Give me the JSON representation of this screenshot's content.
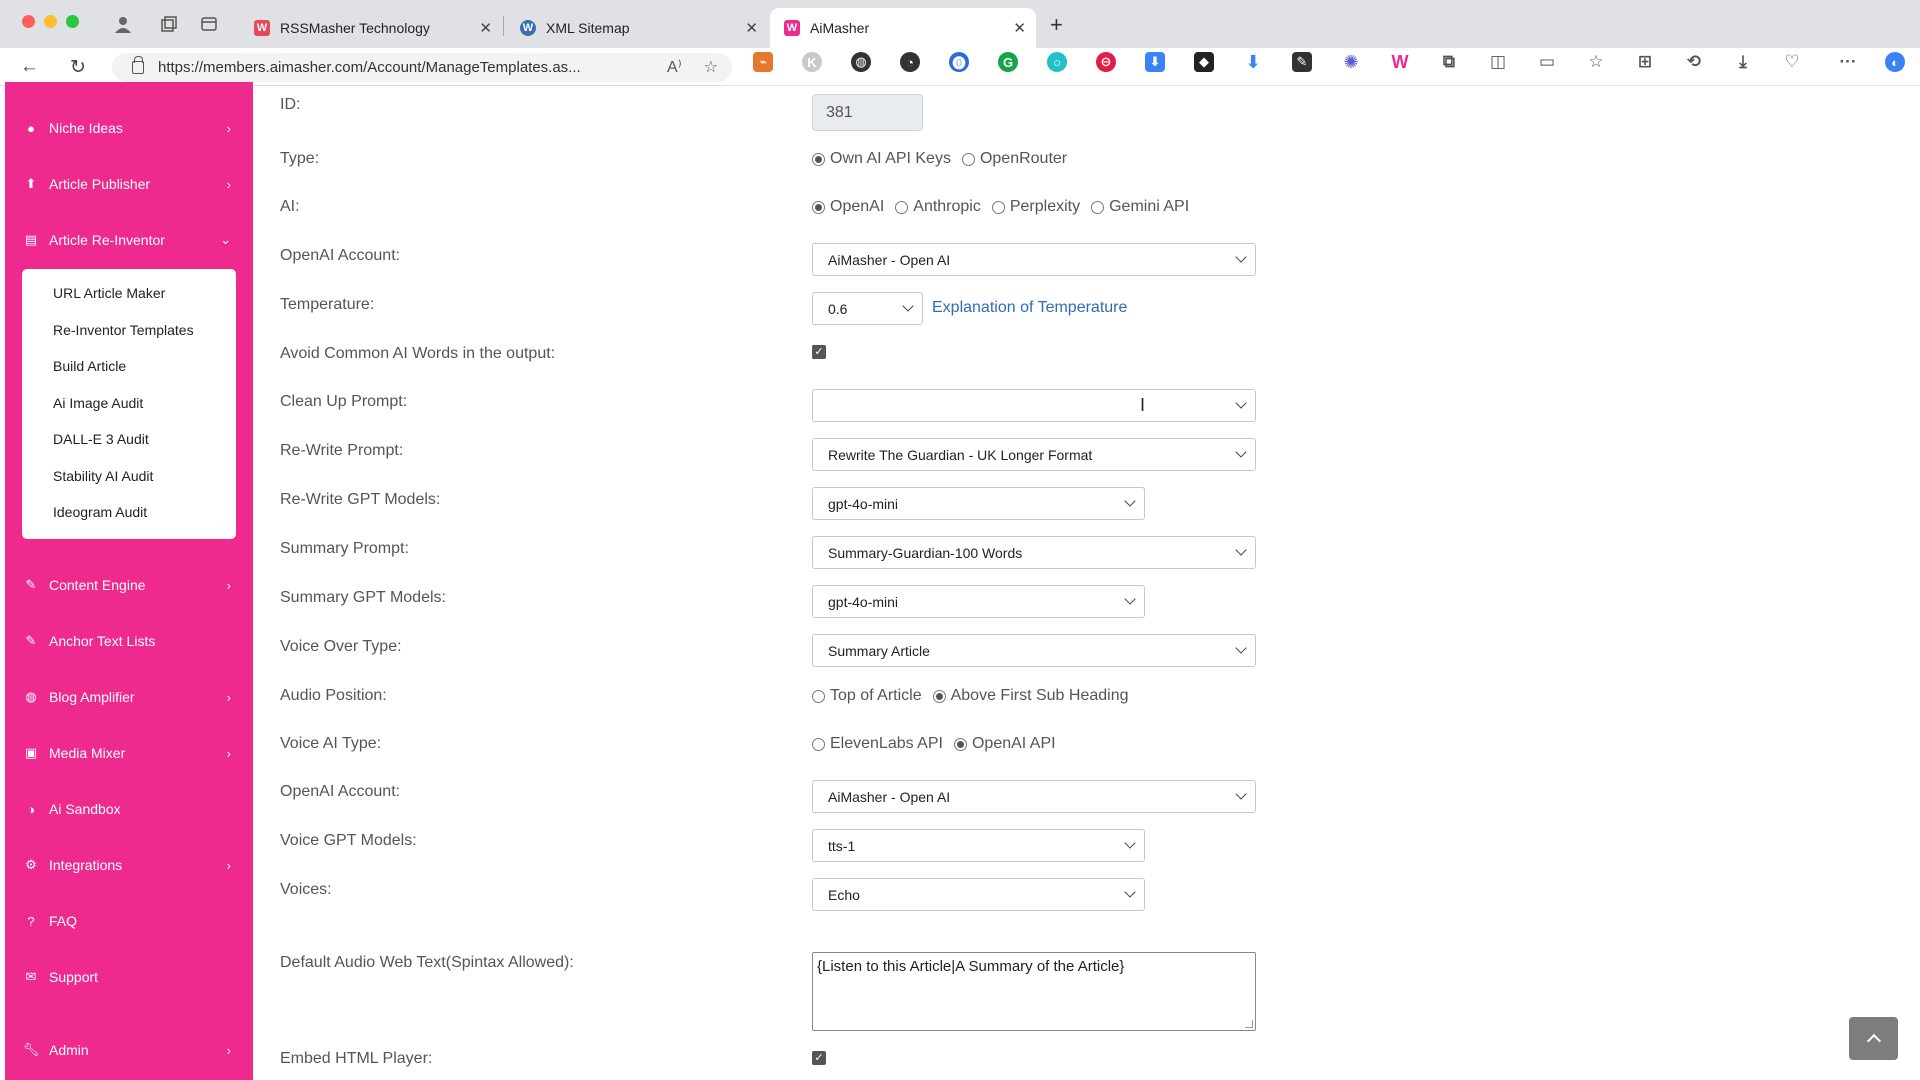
{
  "browser": {
    "tabs": [
      {
        "title": "RSSMasher Technology",
        "active": false
      },
      {
        "title": "XML Sitemap",
        "active": false
      },
      {
        "title": "AiMasher",
        "active": true
      }
    ],
    "url": "https://members.aimasher.com/Account/ManageTemplates.as...",
    "colors": {
      "tabbar": "#dfe1e5",
      "accent": "#ee2a8e"
    }
  },
  "sidebar": {
    "items": [
      {
        "label": "Niche Ideas",
        "icon": "lightbulb-icon",
        "chevron": "right"
      },
      {
        "label": "Article Publisher",
        "icon": "upload-icon",
        "chevron": "right"
      },
      {
        "label": "Article Re-Inventor",
        "icon": "list-icon",
        "chevron": "down"
      },
      {
        "label": "Content Engine",
        "icon": "edit-icon",
        "chevron": "right"
      },
      {
        "label": "Anchor Text Lists",
        "icon": "edit-icon",
        "chevron": ""
      },
      {
        "label": "Blog Amplifier",
        "icon": "globe-icon",
        "chevron": "right"
      },
      {
        "label": "Media Mixer",
        "icon": "image-icon",
        "chevron": "right"
      },
      {
        "label": "Ai Sandbox",
        "icon": "brain-icon",
        "chevron": ""
      },
      {
        "label": "Integrations",
        "icon": "gear-icon",
        "chevron": "right"
      },
      {
        "label": "FAQ",
        "icon": "question-icon",
        "chevron": ""
      },
      {
        "label": "Support",
        "icon": "envelope-icon",
        "chevron": ""
      },
      {
        "label": "Admin",
        "icon": "wrench-icon",
        "chevron": "right"
      }
    ],
    "submenu": [
      "URL Article Maker",
      "Re-Inventor Templates",
      "Build Article",
      "Ai Image Audit",
      "DALL-E 3 Audit",
      "Stability AI Audit",
      "Ideogram Audit"
    ]
  },
  "form": {
    "id": {
      "label": "ID:",
      "value": "381"
    },
    "type": {
      "label": "Type:",
      "options": [
        "Own AI API Keys",
        "OpenRouter"
      ],
      "selected": "Own AI API Keys"
    },
    "ai": {
      "label": "AI:",
      "options": [
        "OpenAI",
        "Anthropic",
        "Perplexity",
        "Gemini API"
      ],
      "selected": "OpenAI"
    },
    "openai_account": {
      "label": "OpenAI Account:",
      "value": "AiMasher - Open AI"
    },
    "temperature": {
      "label": "Temperature:",
      "value": "0.6",
      "link": "Explanation of Temperature"
    },
    "avoid_words": {
      "label": "Avoid Common AI Words in the output:",
      "checked": true
    },
    "cleanup_prompt": {
      "label": "Clean Up Prompt:",
      "value": ""
    },
    "rewrite_prompt": {
      "label": "Re-Write Prompt:",
      "value": "Rewrite The Guardian - UK Longer Format"
    },
    "rewrite_models": {
      "label": "Re-Write GPT Models:",
      "value": "gpt-4o-mini"
    },
    "summary_prompt": {
      "label": "Summary Prompt:",
      "value": "Summary-Guardian-100 Words"
    },
    "summary_models": {
      "label": "Summary GPT Models:",
      "value": "gpt-4o-mini"
    },
    "voice_over_type": {
      "label": "Voice Over Type:",
      "value": "Summary Article"
    },
    "audio_position": {
      "label": "Audio Position:",
      "options": [
        "Top of Article",
        "Above First Sub Heading"
      ],
      "selected": "Above First Sub Heading"
    },
    "voice_ai_type": {
      "label": "Voice AI Type:",
      "options": [
        "ElevenLabs API",
        "OpenAI API"
      ],
      "selected": "OpenAI API"
    },
    "voice_openai_account": {
      "label": "OpenAI Account:",
      "value": "AiMasher - Open AI"
    },
    "voice_models": {
      "label": "Voice GPT Models:",
      "value": "tts-1"
    },
    "voices": {
      "label": "Voices:",
      "value": "Echo"
    },
    "audio_web_text": {
      "label": "Default Audio Web Text(Spintax Allowed):",
      "value": "{Listen to this Article|A Summary of the Article}"
    },
    "embed_player": {
      "label": "Embed HTML Player:",
      "checked": true
    }
  }
}
